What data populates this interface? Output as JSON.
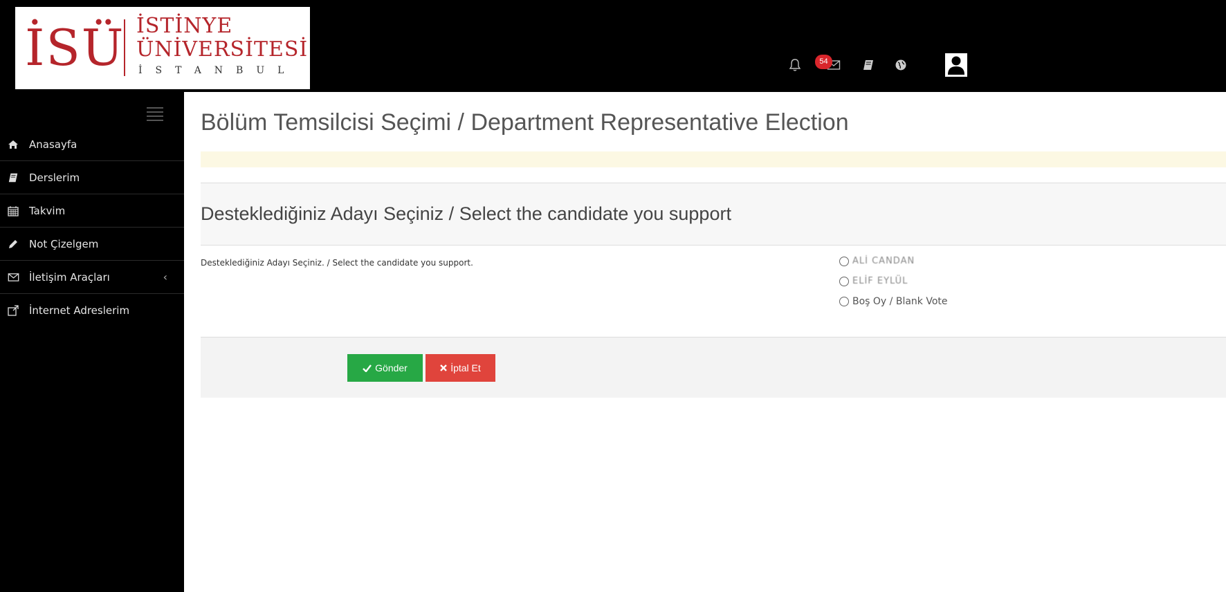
{
  "logo": {
    "mark": "İSÜ",
    "line1": "İSTİNYE",
    "line2": "ÜNİVERSİTESİ",
    "line3": "İSTANBUL"
  },
  "header": {
    "icons": [
      "bell-icon",
      "envelope-icon",
      "book-icon",
      "globe-icon",
      "user-icon"
    ],
    "message_badge": "54"
  },
  "sidebar": {
    "items": [
      {
        "label": "Anasayfa",
        "icon": "home-icon"
      },
      {
        "label": "Derslerim",
        "icon": "book-icon"
      },
      {
        "label": "Takvim",
        "icon": "calendar-icon"
      },
      {
        "label": "Not Çizelgem",
        "icon": "pencil-icon"
      },
      {
        "label": "İletişim Araçları",
        "icon": "envelope-icon",
        "chevron": "‹"
      },
      {
        "label": "İnternet Adreslerim",
        "icon": "external-link-icon"
      }
    ]
  },
  "main": {
    "page_title": "Bölüm Temsilcisi Seçimi / Department Representative Election",
    "panel_title": "Desteklediğiniz Adayı Seçiniz / Select the candidate you support",
    "question_label": "Desteklediğiniz Adayı Seçiniz. / Select the candidate you support.",
    "options": [
      "ALİ CANDAN",
      "ELİF EYLÜL",
      "Boş Oy / Blank Vote"
    ],
    "submit_label": "Gönder",
    "cancel_label": "İptal Et"
  },
  "colors": {
    "accent_red": "#d9262c",
    "submit_green": "#27a845",
    "cancel_red": "#e0443c",
    "logo_red": "#b5252b",
    "alert_bg": "#fcf8e3"
  }
}
